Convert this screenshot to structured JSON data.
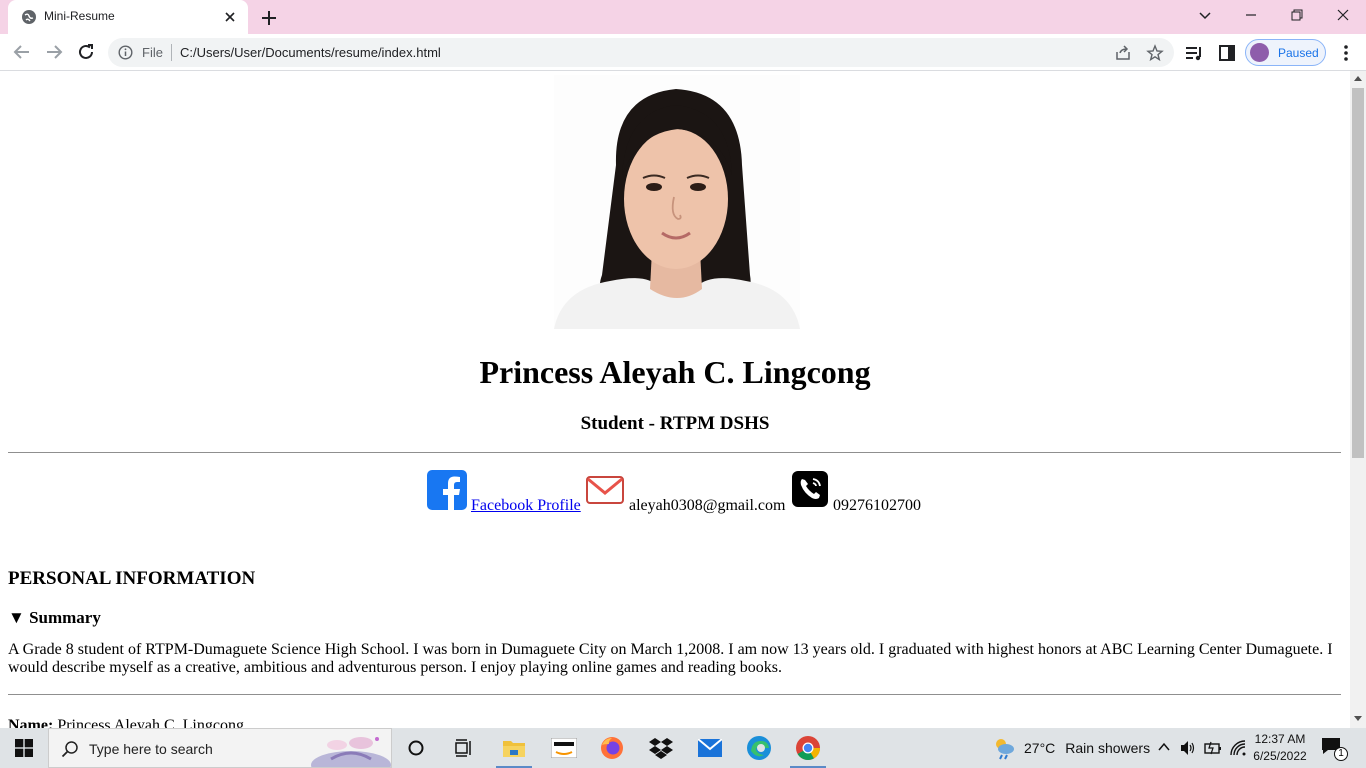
{
  "browser": {
    "tab_title": "Mini-Resume",
    "scheme_label": "File",
    "url": "C:/Users/User/Documents/resume/index.html",
    "profile_label": "Paused"
  },
  "page": {
    "name": "Princess Aleyah C. Lingcong",
    "role": "Student - RTPM DSHS",
    "contacts": {
      "facebook_label": "Facebook Profile",
      "email": "aleyah0308@gmail.com",
      "phone": "09276102700"
    },
    "section_title": "PERSONAL INFORMATION",
    "summary_label": "Summary",
    "summary_marker": "▼",
    "summary_text": "A Grade 8 student of RTPM-Dumaguete Science High School. I was born in Dumaguete City on March 1,2008. I am now 13 years old. I graduated with highest honors at ABC Learning Center Dumaguete. I would describe myself as a creative, ambitious and adventurous person. I enjoy playing online games and reading books.",
    "name_field_label": "Name:",
    "name_field_value": "Princess Aleyah C. Lingcong"
  },
  "taskbar": {
    "search_placeholder": "Type here to search",
    "weather_temp": "27°C",
    "weather_desc": "Rain showers",
    "time": "12:37 AM",
    "date": "6/25/2022",
    "notification_count": "1"
  },
  "colors": {
    "tabstrip": "#f5d3e6",
    "link": "#0000ee",
    "facebook": "#1877f2",
    "taskbar": "#dfe3e6"
  }
}
